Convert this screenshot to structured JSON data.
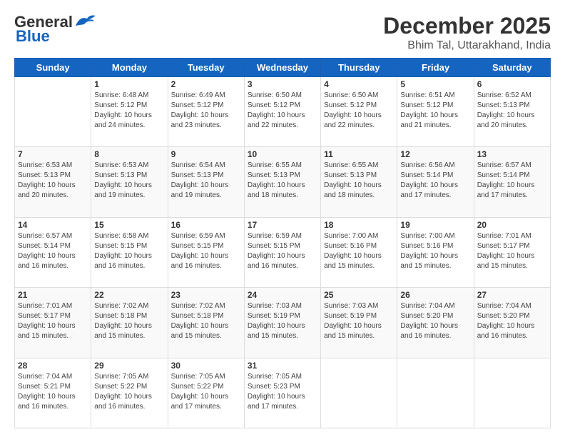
{
  "logo": {
    "line1": "General",
    "line2": "Blue"
  },
  "title": "December 2025",
  "subtitle": "Bhim Tal, Uttarakhand, India",
  "days_header": [
    "Sunday",
    "Monday",
    "Tuesday",
    "Wednesday",
    "Thursday",
    "Friday",
    "Saturday"
  ],
  "weeks": [
    [
      {
        "day": "",
        "info": ""
      },
      {
        "day": "1",
        "info": "Sunrise: 6:48 AM\nSunset: 5:12 PM\nDaylight: 10 hours\nand 24 minutes."
      },
      {
        "day": "2",
        "info": "Sunrise: 6:49 AM\nSunset: 5:12 PM\nDaylight: 10 hours\nand 23 minutes."
      },
      {
        "day": "3",
        "info": "Sunrise: 6:50 AM\nSunset: 5:12 PM\nDaylight: 10 hours\nand 22 minutes."
      },
      {
        "day": "4",
        "info": "Sunrise: 6:50 AM\nSunset: 5:12 PM\nDaylight: 10 hours\nand 22 minutes."
      },
      {
        "day": "5",
        "info": "Sunrise: 6:51 AM\nSunset: 5:12 PM\nDaylight: 10 hours\nand 21 minutes."
      },
      {
        "day": "6",
        "info": "Sunrise: 6:52 AM\nSunset: 5:13 PM\nDaylight: 10 hours\nand 20 minutes."
      }
    ],
    [
      {
        "day": "7",
        "info": "Sunrise: 6:53 AM\nSunset: 5:13 PM\nDaylight: 10 hours\nand 20 minutes."
      },
      {
        "day": "8",
        "info": "Sunrise: 6:53 AM\nSunset: 5:13 PM\nDaylight: 10 hours\nand 19 minutes."
      },
      {
        "day": "9",
        "info": "Sunrise: 6:54 AM\nSunset: 5:13 PM\nDaylight: 10 hours\nand 19 minutes."
      },
      {
        "day": "10",
        "info": "Sunrise: 6:55 AM\nSunset: 5:13 PM\nDaylight: 10 hours\nand 18 minutes."
      },
      {
        "day": "11",
        "info": "Sunrise: 6:55 AM\nSunset: 5:13 PM\nDaylight: 10 hours\nand 18 minutes."
      },
      {
        "day": "12",
        "info": "Sunrise: 6:56 AM\nSunset: 5:14 PM\nDaylight: 10 hours\nand 17 minutes."
      },
      {
        "day": "13",
        "info": "Sunrise: 6:57 AM\nSunset: 5:14 PM\nDaylight: 10 hours\nand 17 minutes."
      }
    ],
    [
      {
        "day": "14",
        "info": "Sunrise: 6:57 AM\nSunset: 5:14 PM\nDaylight: 10 hours\nand 16 minutes."
      },
      {
        "day": "15",
        "info": "Sunrise: 6:58 AM\nSunset: 5:15 PM\nDaylight: 10 hours\nand 16 minutes."
      },
      {
        "day": "16",
        "info": "Sunrise: 6:59 AM\nSunset: 5:15 PM\nDaylight: 10 hours\nand 16 minutes."
      },
      {
        "day": "17",
        "info": "Sunrise: 6:59 AM\nSunset: 5:15 PM\nDaylight: 10 hours\nand 16 minutes."
      },
      {
        "day": "18",
        "info": "Sunrise: 7:00 AM\nSunset: 5:16 PM\nDaylight: 10 hours\nand 15 minutes."
      },
      {
        "day": "19",
        "info": "Sunrise: 7:00 AM\nSunset: 5:16 PM\nDaylight: 10 hours\nand 15 minutes."
      },
      {
        "day": "20",
        "info": "Sunrise: 7:01 AM\nSunset: 5:17 PM\nDaylight: 10 hours\nand 15 minutes."
      }
    ],
    [
      {
        "day": "21",
        "info": "Sunrise: 7:01 AM\nSunset: 5:17 PM\nDaylight: 10 hours\nand 15 minutes."
      },
      {
        "day": "22",
        "info": "Sunrise: 7:02 AM\nSunset: 5:18 PM\nDaylight: 10 hours\nand 15 minutes."
      },
      {
        "day": "23",
        "info": "Sunrise: 7:02 AM\nSunset: 5:18 PM\nDaylight: 10 hours\nand 15 minutes."
      },
      {
        "day": "24",
        "info": "Sunrise: 7:03 AM\nSunset: 5:19 PM\nDaylight: 10 hours\nand 15 minutes."
      },
      {
        "day": "25",
        "info": "Sunrise: 7:03 AM\nSunset: 5:19 PM\nDaylight: 10 hours\nand 15 minutes."
      },
      {
        "day": "26",
        "info": "Sunrise: 7:04 AM\nSunset: 5:20 PM\nDaylight: 10 hours\nand 16 minutes."
      },
      {
        "day": "27",
        "info": "Sunrise: 7:04 AM\nSunset: 5:20 PM\nDaylight: 10 hours\nand 16 minutes."
      }
    ],
    [
      {
        "day": "28",
        "info": "Sunrise: 7:04 AM\nSunset: 5:21 PM\nDaylight: 10 hours\nand 16 minutes."
      },
      {
        "day": "29",
        "info": "Sunrise: 7:05 AM\nSunset: 5:22 PM\nDaylight: 10 hours\nand 16 minutes."
      },
      {
        "day": "30",
        "info": "Sunrise: 7:05 AM\nSunset: 5:22 PM\nDaylight: 10 hours\nand 17 minutes."
      },
      {
        "day": "31",
        "info": "Sunrise: 7:05 AM\nSunset: 5:23 PM\nDaylight: 10 hours\nand 17 minutes."
      },
      {
        "day": "",
        "info": ""
      },
      {
        "day": "",
        "info": ""
      },
      {
        "day": "",
        "info": ""
      }
    ]
  ]
}
